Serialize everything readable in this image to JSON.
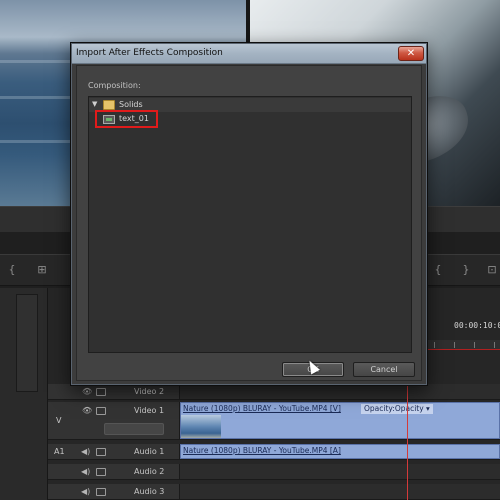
{
  "dialog": {
    "title": "Import After Effects Composition",
    "close_label": "✕",
    "composition_label": "Composition:",
    "tree": {
      "folder": {
        "label": "Solids",
        "icon": "folder-icon",
        "expanded": true
      },
      "item": {
        "label": "text_01",
        "icon": "composition-icon",
        "selected": true
      }
    },
    "ok_label": "OK",
    "cancel_label": "Cancel"
  },
  "timeline": {
    "timecode": "00:00:10:00",
    "tracks": [
      {
        "id": "v2",
        "name": "Video 2",
        "source_label": ""
      },
      {
        "id": "v1",
        "name": "Video 1",
        "source_label": "V",
        "clip_title": "Nature (1080p) BLURAY - YouTube.MP4 [V]",
        "clip_effect": "Opacity:Opacity ▾"
      },
      {
        "id": "a1",
        "name": "Audio 1",
        "source_label": "A1",
        "clip_title": "Nature (1080p) BLURAY - YouTube.MP4 [A]"
      },
      {
        "id": "a2",
        "name": "Audio 2",
        "source_label": ""
      },
      {
        "id": "a3",
        "name": "Audio 3",
        "source_label": ""
      }
    ]
  },
  "colors": {
    "highlight": "#e01b1b",
    "clip": "#8fa8d8",
    "playhead": "#d43a3a"
  }
}
